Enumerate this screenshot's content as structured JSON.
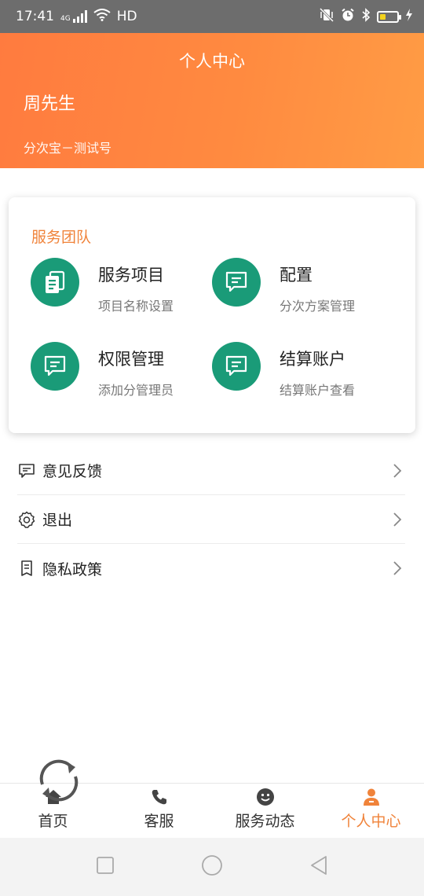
{
  "status_bar": {
    "time": "17:41",
    "network": "4G",
    "hd": "HD",
    "battery_level": 0.35
  },
  "header": {
    "title": "个人中心",
    "user_name": "周先生",
    "account": "分次宝－测试号"
  },
  "service_team": {
    "title": "服务团队",
    "items": [
      {
        "name": "服务项目",
        "desc": "项目名称设置",
        "icon": "document-icon"
      },
      {
        "name": "配置",
        "desc": "分次方案管理",
        "icon": "message-icon"
      },
      {
        "name": "权限管理",
        "desc": "添加分管理员",
        "icon": "message-icon"
      },
      {
        "name": "结算账户",
        "desc": "结算账户查看",
        "icon": "message-icon"
      }
    ]
  },
  "menu": [
    {
      "label": "意见反馈",
      "icon": "feedback-icon"
    },
    {
      "label": "退出",
      "icon": "gear-icon"
    },
    {
      "label": "隐私政策",
      "icon": "doc-icon"
    }
  ],
  "tabbar": [
    {
      "label": "首页",
      "icon": "home-icon"
    },
    {
      "label": "客服",
      "icon": "phone-icon"
    },
    {
      "label": "服务动态",
      "icon": "smiley-icon"
    },
    {
      "label": "个人中心",
      "icon": "person-icon",
      "active": true
    }
  ],
  "colors": {
    "accent": "#f0833a",
    "header_start": "#ff7b3f",
    "header_end": "#ff9c45",
    "icon_green": "#1a9b78"
  }
}
